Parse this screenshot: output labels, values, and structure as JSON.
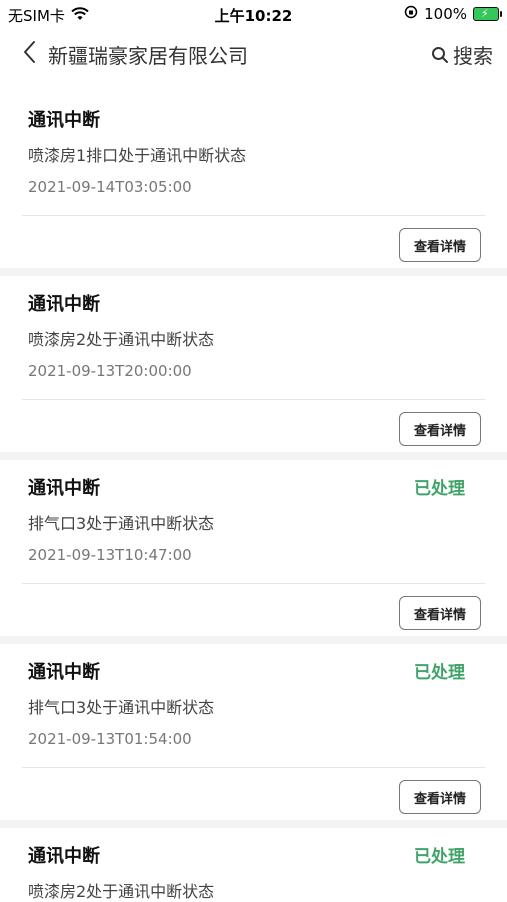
{
  "status_bar": {
    "carrier": "无SIM卡",
    "time": "上午10:22",
    "battery": "100%"
  },
  "header": {
    "title": "新疆瑞豪家居有限公司",
    "search_label": "搜索"
  },
  "items": [
    {
      "title": "通讯中断",
      "status": "",
      "desc": "喷漆房1排口处于通讯中断状态",
      "time": "2021-09-14T03:05:00",
      "button": "查看详情"
    },
    {
      "title": "通讯中断",
      "status": "",
      "desc": "喷漆房2处于通讯中断状态",
      "time": "2021-09-13T20:00:00",
      "button": "查看详情"
    },
    {
      "title": "通讯中断",
      "status": "已处理",
      "desc": "排气口3处于通讯中断状态",
      "time": "2021-09-13T10:47:00",
      "button": "查看详情"
    },
    {
      "title": "通讯中断",
      "status": "已处理",
      "desc": "排气口3处于通讯中断状态",
      "time": "2021-09-13T01:54:00",
      "button": "查看详情"
    },
    {
      "title": "通讯中断",
      "status": "已处理",
      "desc": "喷漆房2处于通讯中断状态",
      "time": "",
      "button": ""
    }
  ],
  "colors": {
    "handled": "#41a46b",
    "separator": "#f3f3f3"
  }
}
